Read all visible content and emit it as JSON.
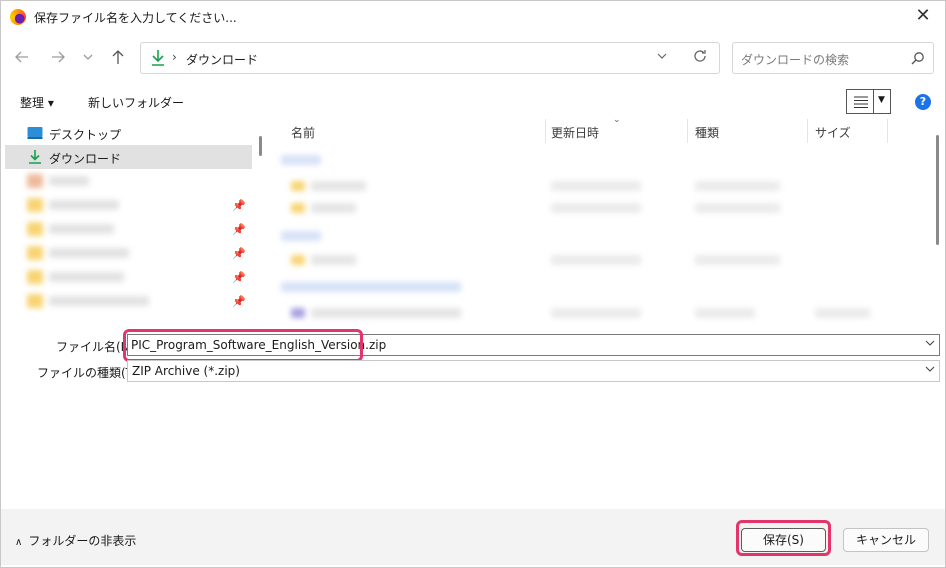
{
  "window": {
    "title": "保存ファイル名を入力してください...",
    "close_symbol": "✕"
  },
  "nav": {
    "breadcrumb_sep": "›",
    "location": "ダウンロード",
    "search_placeholder": "ダウンロードの検索"
  },
  "toolbar": {
    "organize_label": "整理 ▾",
    "new_folder_label": "新しいフォルダー",
    "help_label": "?"
  },
  "tree": {
    "items": [
      {
        "label": "デスクトップ",
        "icon": "desktop-icon"
      },
      {
        "label": "ダウンロード",
        "icon": "download-icon",
        "selected": true
      }
    ]
  },
  "file_list": {
    "columns": [
      "名前",
      "更新日時",
      "種類",
      "サイズ"
    ]
  },
  "form": {
    "filename_label": "ファイル名(N):",
    "filename_value": "PIC_Program_Software_English_Version.zip",
    "filetype_label": "ファイルの種類(T):",
    "filetype_value": "ZIP Archive (*.zip)"
  },
  "footer": {
    "hide_folders_label": "フォルダーの非表示",
    "save_label": "保存(S)",
    "cancel_label": "キャンセル"
  },
  "colors": {
    "highlight": "#e5336b",
    "accent": "#1a73e8",
    "download_arrow": "#18a04c"
  }
}
